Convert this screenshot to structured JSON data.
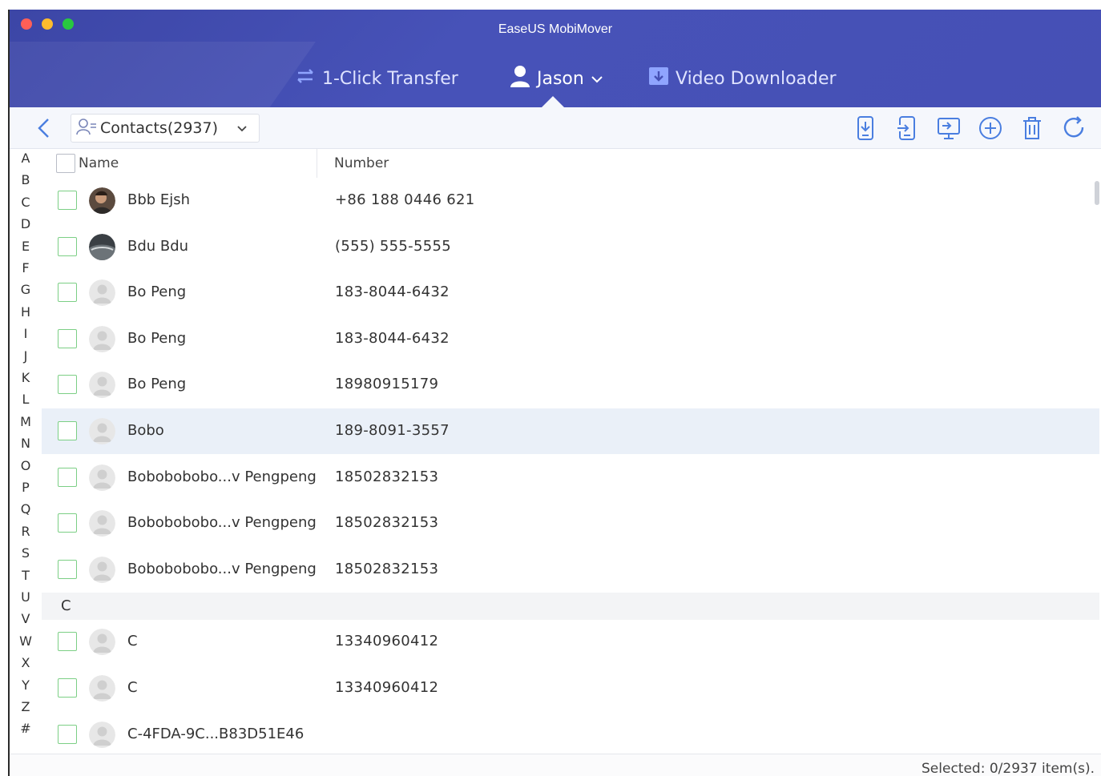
{
  "window": {
    "title": "EaseUS MobiMover"
  },
  "nav": {
    "transfer_label": "1-Click Transfer",
    "device_label": "Jason",
    "video_label": "Video Downloader"
  },
  "toolbar": {
    "category_label": "Contacts(2937)",
    "tools": [
      "export-to-device-icon",
      "import-to-phone-icon",
      "transfer-to-computer-icon",
      "add-icon",
      "delete-icon",
      "refresh-icon"
    ]
  },
  "alphabet": [
    "A",
    "B",
    "C",
    "D",
    "E",
    "F",
    "G",
    "H",
    "I",
    "J",
    "K",
    "L",
    "M",
    "N",
    "O",
    "P",
    "Q",
    "R",
    "S",
    "T",
    "U",
    "V",
    "W",
    "X",
    "Y",
    "Z",
    "#"
  ],
  "table": {
    "columns": {
      "name": "Name",
      "number": "Number"
    },
    "rows": [
      {
        "name": "Bbb Ejsh",
        "number": "+86 188 0446 621"
      },
      {
        "name": "Bdu Bdu",
        "number": "(555) 555-5555"
      },
      {
        "name": "Bo Peng",
        "number": "183-8044-6432"
      },
      {
        "name": "Bo Peng",
        "number": "183-8044-6432"
      },
      {
        "name": "Bo Peng",
        "number": "18980915179"
      },
      {
        "name": "Bobo",
        "number": "189-8091-3557"
      },
      {
        "name": "Bobobobobo...v Pengpeng",
        "number": "18502832153"
      },
      {
        "name": "Bobobobobo...v Pengpeng",
        "number": "18502832153"
      },
      {
        "name": "Bobobobobo...v Pengpeng",
        "number": "18502832153"
      }
    ],
    "section_c": "C",
    "rows_c": [
      {
        "name": "C",
        "number": "13340960412"
      },
      {
        "name": "C",
        "number": "13340960412"
      },
      {
        "name": "C-4FDA-9C...B83D51E46",
        "number": ""
      }
    ]
  },
  "status": {
    "selected": "Selected: 0/2937 item(s)."
  },
  "colors": {
    "header": "#4650b5",
    "checkbox_border": "#7ccf85",
    "highlight_row": "#eaf0f8"
  }
}
